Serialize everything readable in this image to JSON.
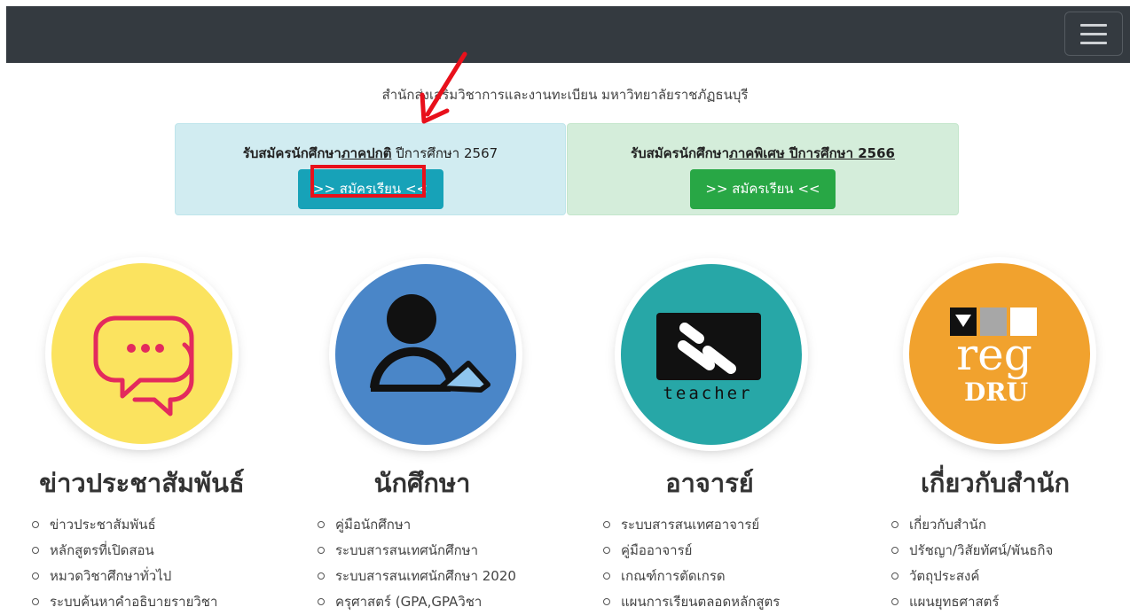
{
  "navbar": {
    "menu_toggle": "hamburger-menu"
  },
  "header": {
    "subtitle": "สำนักส่งเสริมวิชาการและงานทะเบียน มหาวิทยาลัยราชภัฏธนบุรี"
  },
  "admission": {
    "regular": {
      "prefix": "รับสมัครนักศึกษา",
      "term": "ภาคปกติ",
      "year": " ปีการศึกษา 2567",
      "button": ">> สมัครเรียน <<"
    },
    "special": {
      "prefix": "รับสมัครนักศึกษา",
      "term": "ภาคพิเศษ ปีการศึกษา 2566",
      "button": ">> สมัครเรียน <<"
    }
  },
  "sections": [
    {
      "title": "ข่าวประชาสัมพันธ์",
      "items": [
        "ข่าวประชาสัมพันธ์",
        "หลักสูตรที่เปิดสอน",
        "หมวดวิชาศึกษาทั่วไป",
        "ระบบค้นหาคำอธิบายรายวิชา"
      ]
    },
    {
      "title": "นักศึกษา",
      "items": [
        "คู่มือนักศึกษา",
        "ระบบสารสนเทศนักศึกษา",
        "ระบบสารสนเทศนักศึกษา 2020",
        "ครุศาสตร์ (GPA,GPAวิชา"
      ]
    },
    {
      "title": "อาจารย์",
      "teacher_logo_text": "teacher",
      "items": [
        "ระบบสารสนเทศอาจารย์",
        "คู่มืออาจารย์",
        "เกณฑ์การตัดเกรด",
        "แผนการเรียนตลอดหลักสูตร"
      ]
    },
    {
      "title": "เกี่ยวกับสำนัก",
      "reg_logo_text": "reg",
      "reg_logo_sub": "DRU",
      "items": [
        "เกี่ยวกับสำนัก",
        "ปรัชญา/วิสัยทัศน์/พันธกิจ",
        "วัตถุประสงค์",
        "แผนยุทธศาสตร์"
      ]
    }
  ],
  "colors": {
    "navbar": "#343a40",
    "info_button": "#17a2b8",
    "success_button": "#28a745",
    "highlight": "#e8101b"
  }
}
